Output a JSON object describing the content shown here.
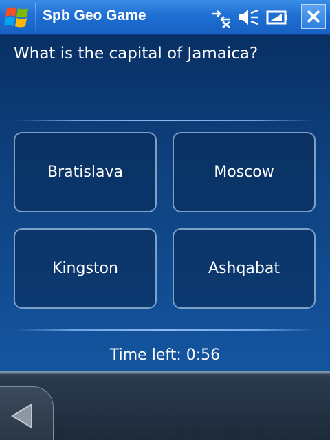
{
  "titlebar": {
    "title": "Spb Geo Game",
    "icons": [
      "windows-start-icon",
      "network-icon",
      "speaker-icon",
      "battery-icon",
      "close-icon"
    ]
  },
  "quiz": {
    "question": "What is the capital of Jamaica?",
    "answers": [
      "Bratislava",
      "Moscow",
      "Kingston",
      "Ashqabat"
    ],
    "timer_label": "Time left: 0:56"
  },
  "bottombar": {
    "icons": [
      "back-arrow-icon"
    ]
  },
  "colors": {
    "titlebar": "#1f6fd3",
    "background": "#0e3f7c",
    "answer_border": "#7e9fc6",
    "bottombar": "#2a3a4d"
  }
}
